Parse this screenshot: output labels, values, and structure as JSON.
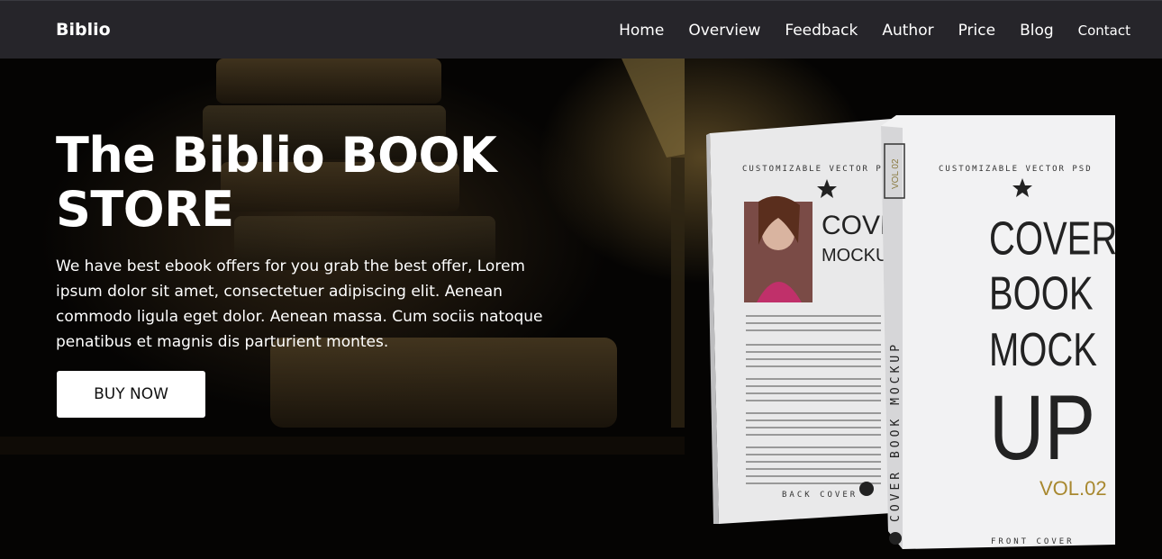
{
  "brand": "Biblio",
  "nav": [
    "Home",
    "Overview",
    "Feedback",
    "Author",
    "Price",
    "Blog",
    "Contact"
  ],
  "hero": {
    "title": "The Biblio BOOK STORE",
    "text": "We have best ebook offers for you grab the best offer, Lorem ipsum dolor sit amet, consectetuer adipiscing elit. Aenean commodo ligula eget dolor. Aenean massa. Cum sociis natoque penatibus et magnis dis parturient montes.",
    "button": "BUY NOW"
  },
  "mockup": {
    "top_label": "CUSTOMIZABLE VECTOR PSD",
    "back_title": "COVER BO",
    "back_subtitle": "MOCKUP V",
    "front_line1": "COVER",
    "front_line2": "BOOK",
    "front_line3": "MOCK",
    "front_line4": "UP",
    "vol": "VOL.02",
    "vol_badge": "VOL 02",
    "spine": "COVER BOOK MOCKUP",
    "back_label": "BACK COVER",
    "front_label": "FRONT COVER"
  }
}
